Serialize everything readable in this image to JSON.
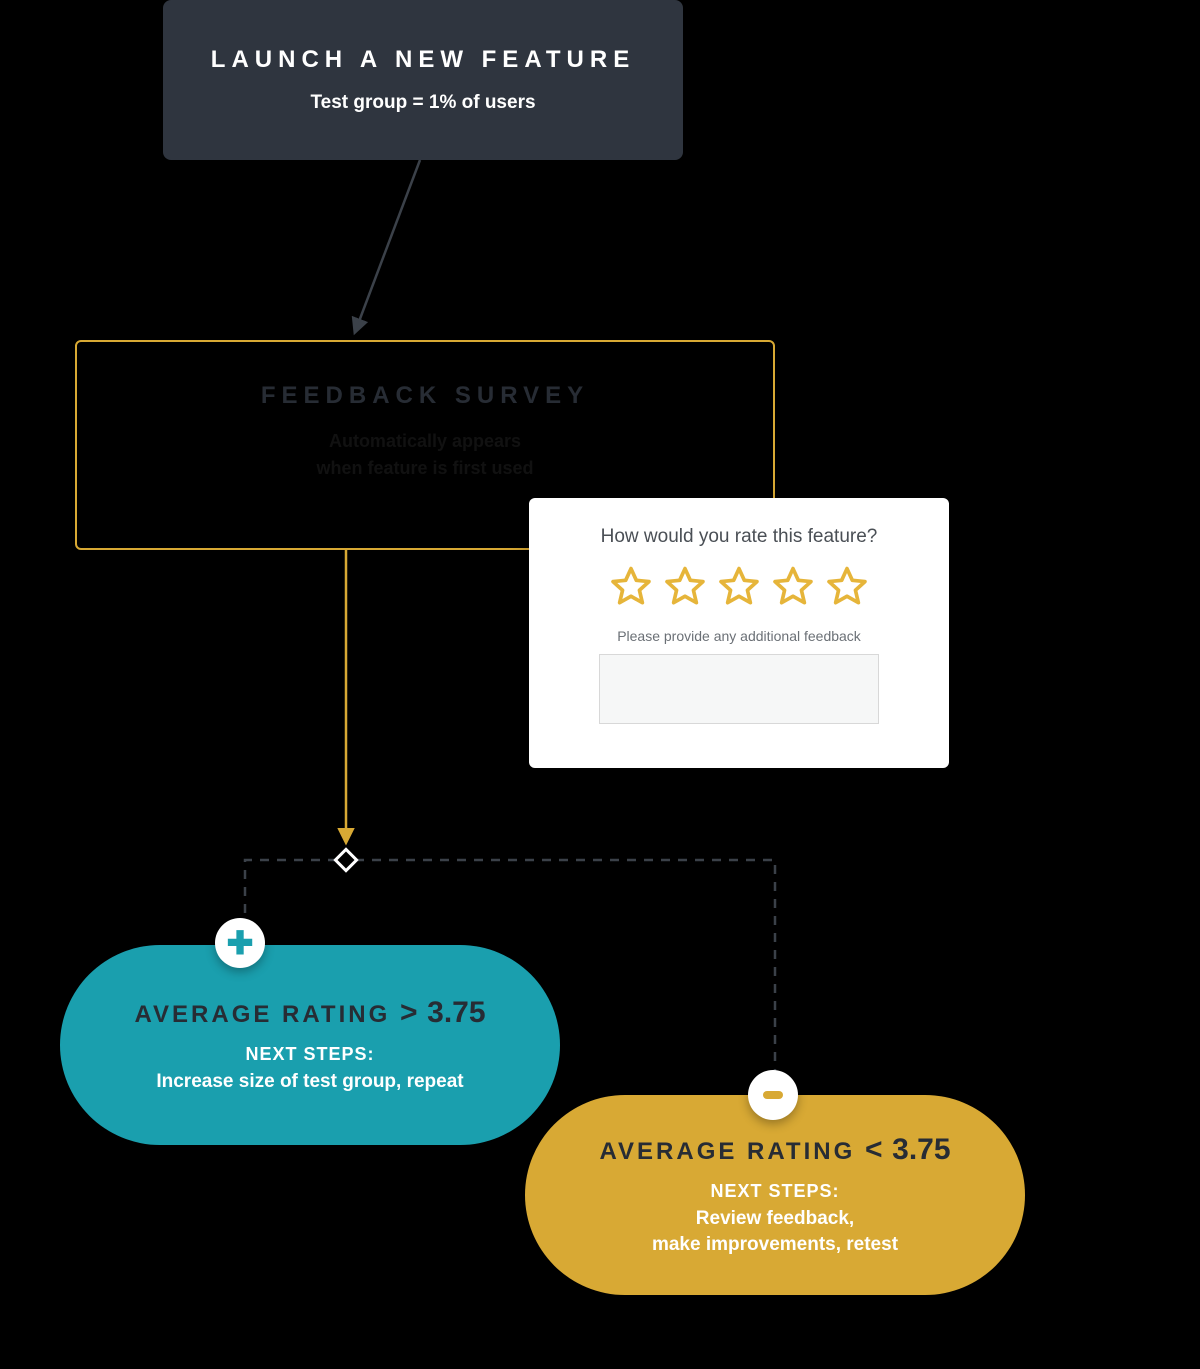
{
  "launch": {
    "title": "LAUNCH A NEW FEATURE",
    "subtitle": "Test group = 1% of users"
  },
  "survey": {
    "title": "FEEDBACK SURVEY",
    "line1": "Automatically appears",
    "line2": "when feature is first used"
  },
  "ratingCard": {
    "question": "How would you rate this feature?",
    "additional": "Please provide any additional feedback",
    "stars": 5
  },
  "outcomes": {
    "positive": {
      "label": "AVERAGE RATING",
      "symbol": ">",
      "threshold": "3.75",
      "nextLabel": "NEXT STEPS:",
      "next": "Increase size of test group, repeat"
    },
    "negative": {
      "label": "AVERAGE RATING",
      "symbol": "<",
      "threshold": "3.75",
      "nextLabel": "NEXT STEPS:",
      "next": "Review feedback,\nmake improvements, retest"
    }
  }
}
